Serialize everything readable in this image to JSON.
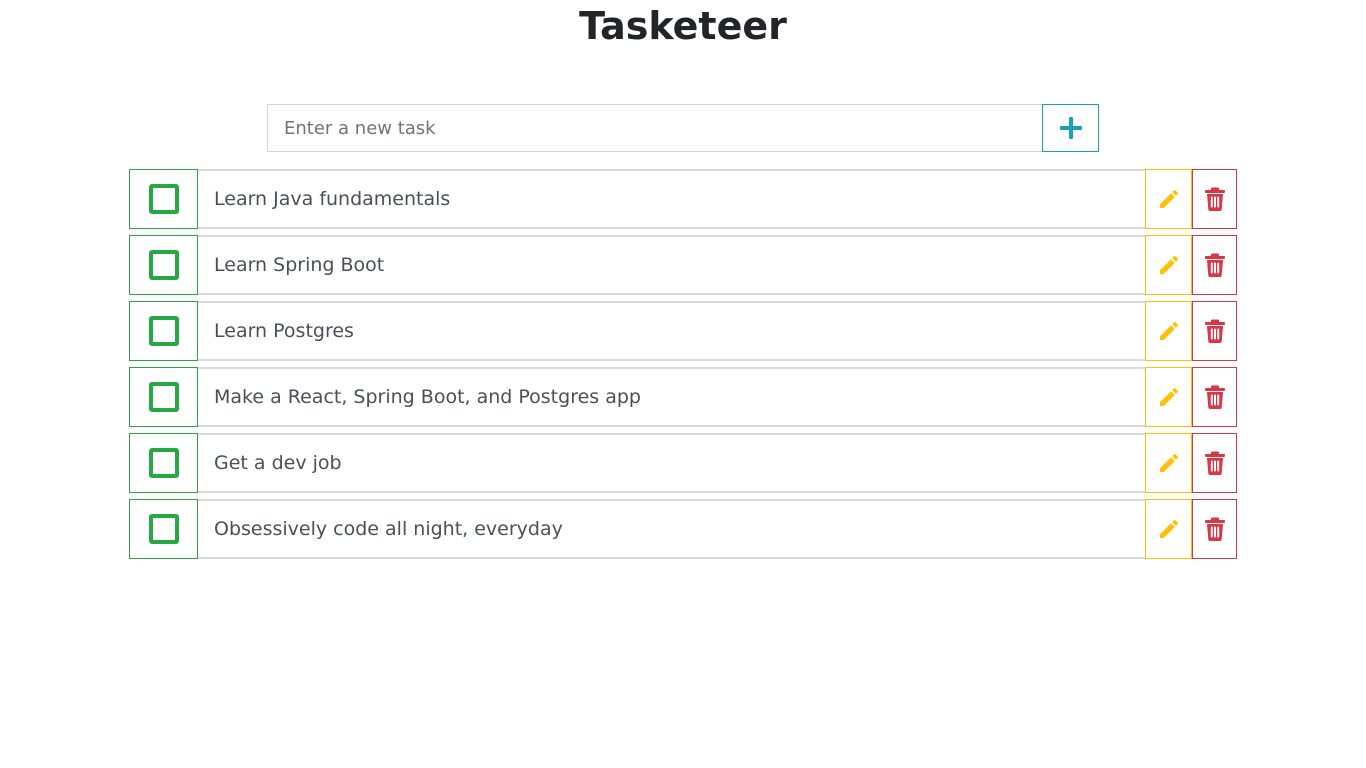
{
  "app": {
    "title": "Tasketeer"
  },
  "new_task": {
    "placeholder": "Enter a new task",
    "value": "",
    "add_icon": "plus-icon"
  },
  "colors": {
    "complete": "#28a745",
    "edit": "#ffc107",
    "delete": "#dc3545",
    "add": "#17a2b8"
  },
  "tasks": [
    {
      "text": "Learn Java fundamentals",
      "completed": false
    },
    {
      "text": "Learn Spring Boot",
      "completed": false
    },
    {
      "text": "Learn Postgres",
      "completed": false
    },
    {
      "text": "Make a React, Spring Boot, and Postgres app",
      "completed": false
    },
    {
      "text": "Get a dev job",
      "completed": false
    },
    {
      "text": "Obsessively code all night, everyday",
      "completed": false
    }
  ],
  "icons": {
    "edit": "pencil-icon",
    "delete": "trash-icon",
    "check": "checkbox-icon"
  }
}
